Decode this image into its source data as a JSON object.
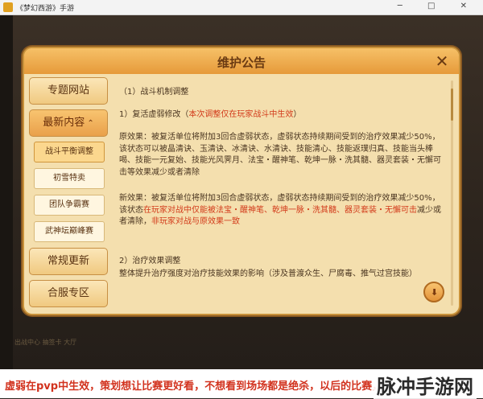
{
  "window": {
    "title": "《梦幻西游》手游",
    "controls": "─ □ ✕"
  },
  "background": {
    "behind_text": "出战中心 抽签卡 大厅"
  },
  "dialog": {
    "title": "维护公告",
    "close_icon": "close-icon",
    "sidebar": {
      "main_items": [
        {
          "label": "专题网站"
        },
        {
          "label": "最新内容",
          "chevron": "⌃"
        },
        {
          "label": "常规更新"
        },
        {
          "label": "合服专区"
        }
      ],
      "sub_items": [
        {
          "label": "战斗平衡调整"
        },
        {
          "label": "初雪特卖"
        },
        {
          "label": "团队争霸赛"
        },
        {
          "label": "武神坛巅峰赛"
        }
      ]
    },
    "content": {
      "section1_heading": "（1）战斗机制调整",
      "item1_heading_a": "1）复活虚弱修改（",
      "item1_heading_red": "本次调整仅在玩家战斗中生效",
      "item1_heading_b": "）",
      "original_effect": "原效果：被复活单位将附加3回合虚弱状态，虚弱状态持续期间受到的治疗效果减少50%，该状态可以被晶清诀、玉清诀、冰清诀、水清诀、技能清心、技能返璞归真、技能当头棒喝、技能一元复始、技能光风霁月、法宝・醒神笔、乾坤一脉・洗其髓、器灵套装・无懈可击等效果减少或者清除",
      "new_effect_a": "新效果：被复活单位将附加3回合虚弱状态，虚弱状态持续期间受到的治疗效果减少50%，该状态",
      "new_effect_red": "在玩家对战中仅能被法宝・醒神笔、乾坤一脉・洗其髓、器灵套装・无懈可击",
      "new_effect_b": "减少或者清除，",
      "new_effect_red2": "非玩家对战与原效果一致",
      "item2_heading": "2）治疗效果调整",
      "item2_text": "整体提升治疗强度对治疗技能效果的影响（涉及普渡众生、尸腐毒、推气过宫技能）"
    },
    "download_icon": "download-icon"
  },
  "caption": {
    "text": "虚弱在pvp中生效，策划想让比赛更好看，不想看到场场都是绝杀，以后的比赛，",
    "watermark": "脉冲手游网"
  },
  "colors": {
    "accent_red": "#d23a1a",
    "dialog_bg": "#f4dfae",
    "header_orange": "#e69a3a"
  }
}
